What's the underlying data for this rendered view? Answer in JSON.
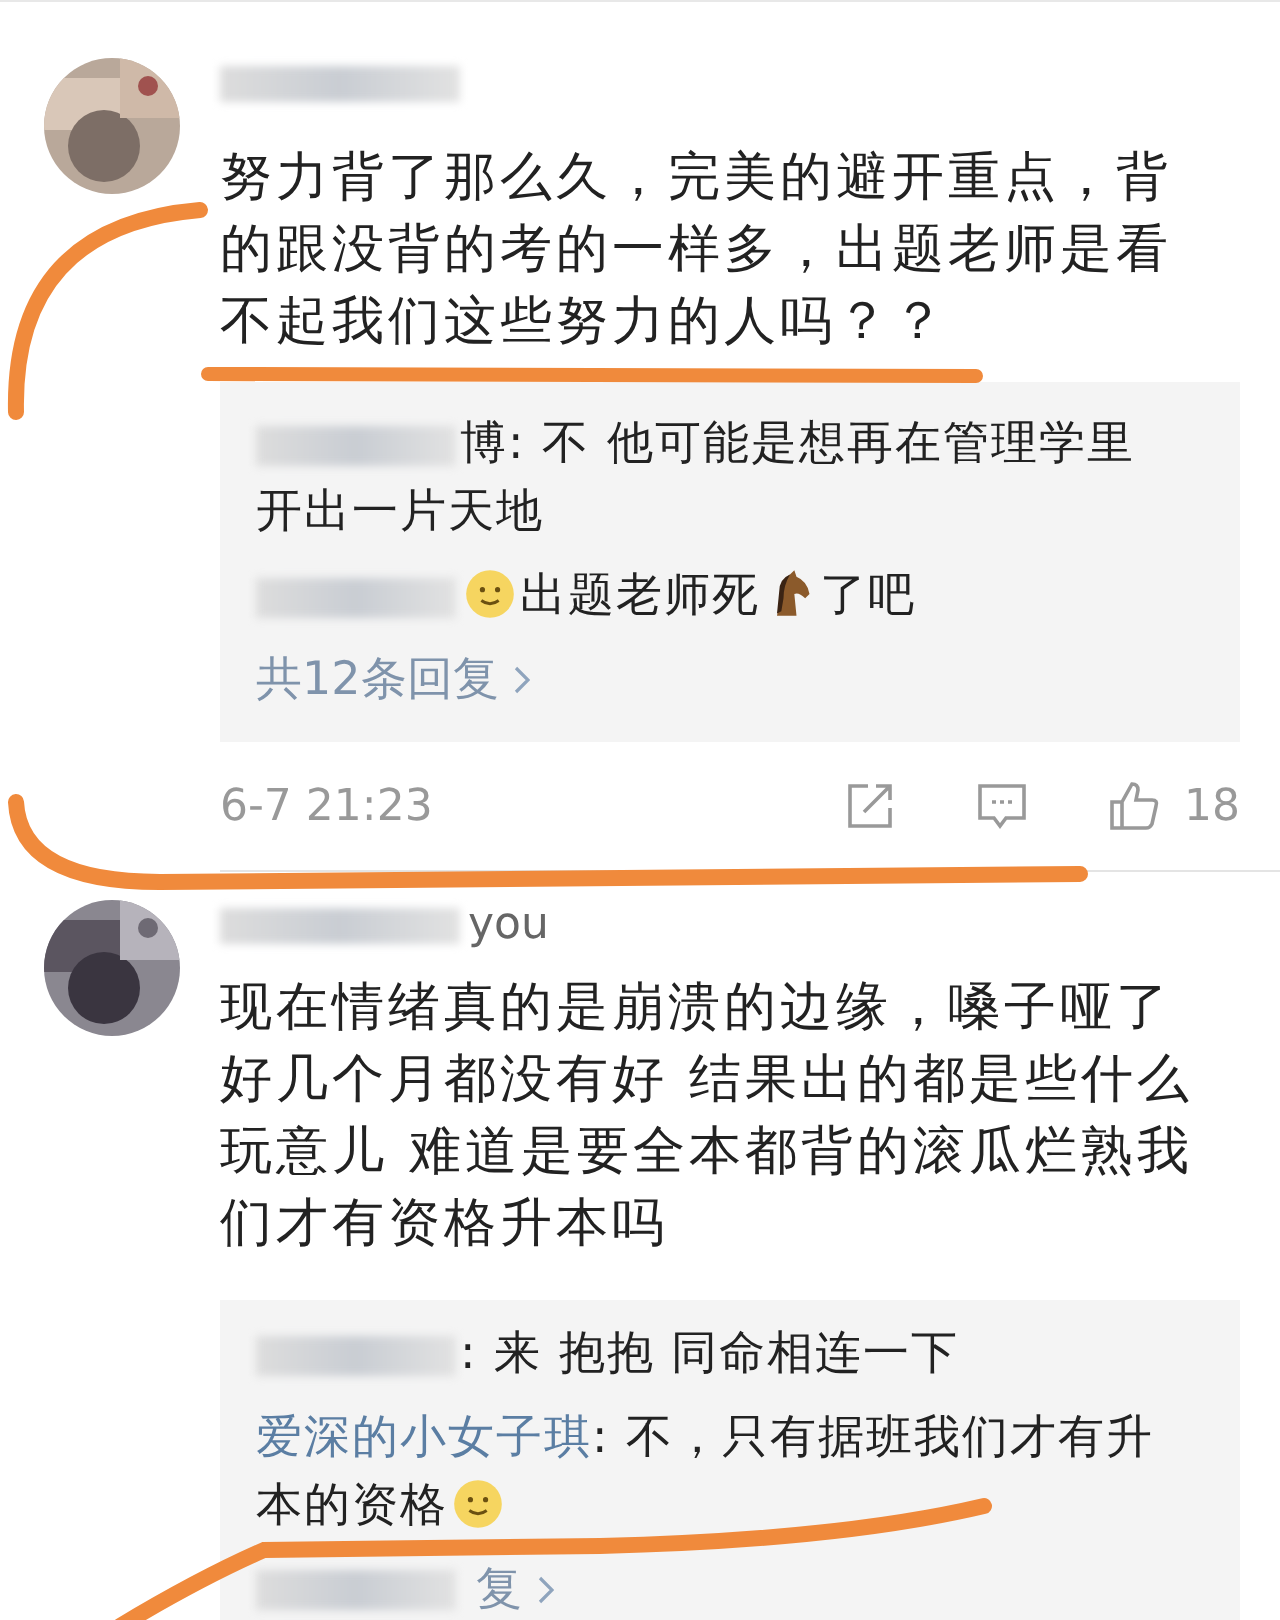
{
  "comments": [
    {
      "text": "努力背了那么久，完美的避开重点，背的跟没背的考的一样多，出题老师是看不起我们这些努力的人吗？？",
      "replies": [
        {
          "parts": [
            {
              "kind": "text",
              "text": "博: 不 他可能是想再在管理学里"
            },
            {
              "kind": "text",
              "text": "开出一片天地"
            }
          ]
        },
        {
          "parts": [
            {
              "kind": "smiley"
            },
            {
              "kind": "text",
              "text": "出题老师死"
            },
            {
              "kind": "horse"
            },
            {
              "kind": "text",
              "text": " 了吧"
            }
          ]
        }
      ],
      "more_replies": "共12条回复",
      "time": "6-7 21:23",
      "likes": "18"
    },
    {
      "username": "you",
      "text": "现在情绪真的是崩溃的边缘，嗓子哑了好几个月都没有好 结果出的都是些什么玩意儿 难道是要全本都背的滚瓜烂熟我们才有资格升本吗",
      "replies": [
        {
          "parts": [
            {
              "kind": "text",
              "text": ": 来 抱抱 同命相连一下"
            }
          ]
        },
        {
          "author": "爱深的小女子琪",
          "parts": [
            {
              "kind": "text",
              "text": ": 不，只有据班我们才有升"
            },
            {
              "kind": "text",
              "text": "本的资格"
            },
            {
              "kind": "smiley"
            }
          ]
        }
      ],
      "more_replies": "复"
    }
  ]
}
